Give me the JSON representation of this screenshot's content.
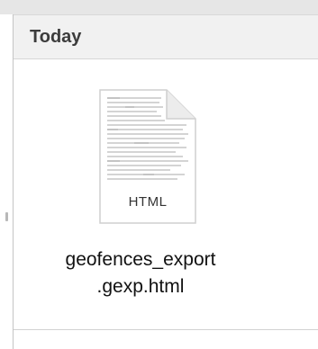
{
  "section": {
    "title": "Today"
  },
  "file": {
    "type_label": "HTML",
    "name_line1": "geofences_export",
    "name_line2": ".gexp.html",
    "icon": "html-document-icon"
  }
}
